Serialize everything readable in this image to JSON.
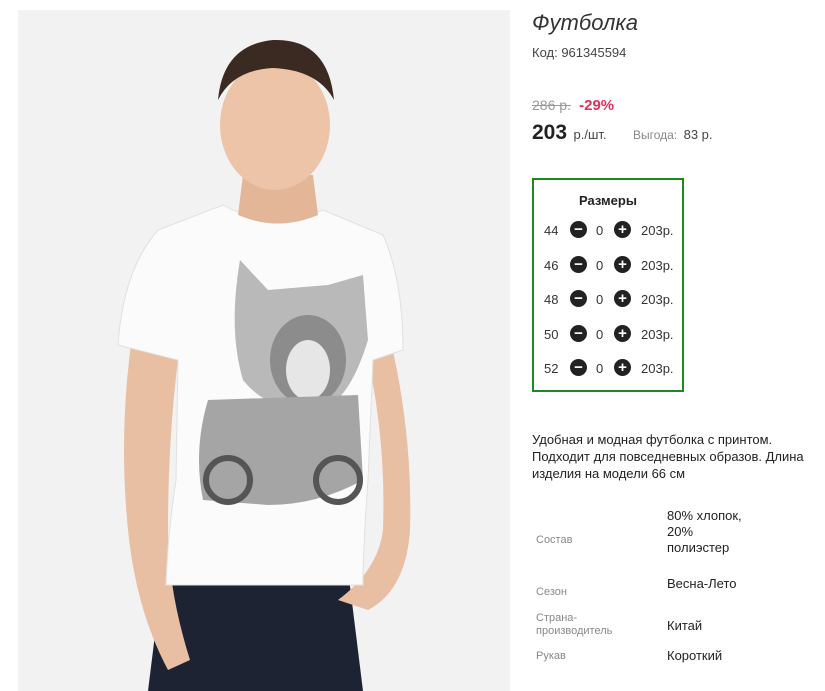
{
  "product": {
    "title": "Футболка",
    "code": "Код: 961345594",
    "old_price": "286 р.",
    "discount": "-29%",
    "price": "203",
    "price_unit": "р./шт.",
    "benefit_label": "Выгода:",
    "benefit_value": "83 р."
  },
  "sizes": {
    "title": "Размеры",
    "rows": [
      {
        "size": "44",
        "qty": "0",
        "price": "203р."
      },
      {
        "size": "46",
        "qty": "0",
        "price": "203р."
      },
      {
        "size": "48",
        "qty": "0",
        "price": "203р."
      },
      {
        "size": "50",
        "qty": "0",
        "price": "203р."
      },
      {
        "size": "52",
        "qty": "0",
        "price": "203р."
      }
    ]
  },
  "description": "Удобная и модная футболка с принтом. Подходит для повседневных образов. Длина изделия на модели 66 см",
  "specs": [
    {
      "label": "Состав",
      "value": "80% хлопок, 20% полиэстер"
    },
    {
      "label": "Сезон",
      "value": "Весна-Лето"
    },
    {
      "label": "Страна-производитель",
      "value": "Китай"
    },
    {
      "label": "Рукав",
      "value": "Короткий"
    }
  ],
  "icons": {
    "minus": "minus-circle-icon",
    "plus": "plus-circle-icon"
  },
  "colors": {
    "discount": "#e2315a",
    "sizes_border": "#1a8a1a"
  }
}
